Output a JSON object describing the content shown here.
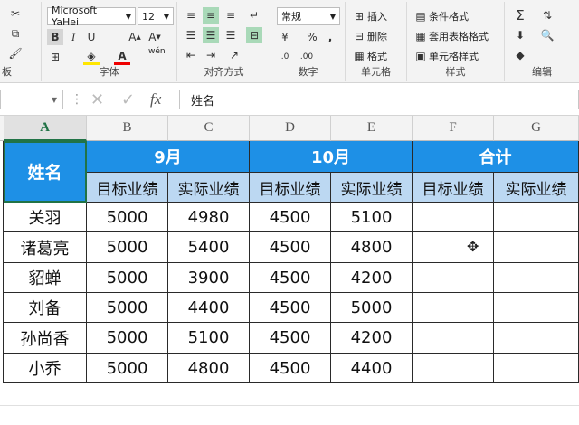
{
  "ribbon": {
    "font_name": "Microsoft YaHei",
    "font_size": "12",
    "font_group_label": "字体",
    "align_group_label": "对齐方式",
    "number_format": "常规",
    "number_group_label": "数字",
    "percent_symbol": "%",
    "comma_symbol": ",",
    "cells_group_label": "单元格",
    "styles_group_label": "样式",
    "edit_group_label": "编辑",
    "clipboard_group_label": "板",
    "insert_label": "插入",
    "delete_label": "删除",
    "format_label": "格式",
    "conditional_format_label": "条件格式",
    "table_format_label": "套用表格格式",
    "cell_style_label": "单元格样式",
    "bold": "B",
    "italic": "I",
    "underline": "U",
    "wen": "wén"
  },
  "formula_bar": {
    "fx": "fx",
    "content": "姓名"
  },
  "columns": [
    "A",
    "B",
    "C",
    "D",
    "E",
    "F",
    "G"
  ],
  "selected_column": "A",
  "table": {
    "name_header": "姓名",
    "months": [
      "9月",
      "10月",
      "合计"
    ],
    "sub_headers": [
      "目标业绩",
      "实际业绩",
      "目标业绩",
      "实际业绩",
      "目标业绩",
      "实际业绩"
    ],
    "rows": [
      {
        "name": "关羽",
        "values": [
          "5000",
          "4980",
          "4500",
          "5100",
          "",
          ""
        ]
      },
      {
        "name": "诸葛亮",
        "values": [
          "5000",
          "5400",
          "4500",
          "4800",
          "",
          ""
        ]
      },
      {
        "name": "貂蝉",
        "values": [
          "5000",
          "3900",
          "4500",
          "4200",
          "",
          ""
        ]
      },
      {
        "name": "刘备",
        "values": [
          "5000",
          "4400",
          "4500",
          "5000",
          "",
          ""
        ]
      },
      {
        "name": "孙尚香",
        "values": [
          "5000",
          "5100",
          "4500",
          "4200",
          "",
          ""
        ]
      },
      {
        "name": "小乔",
        "values": [
          "5000",
          "4800",
          "4500",
          "4400",
          "",
          ""
        ]
      }
    ]
  }
}
